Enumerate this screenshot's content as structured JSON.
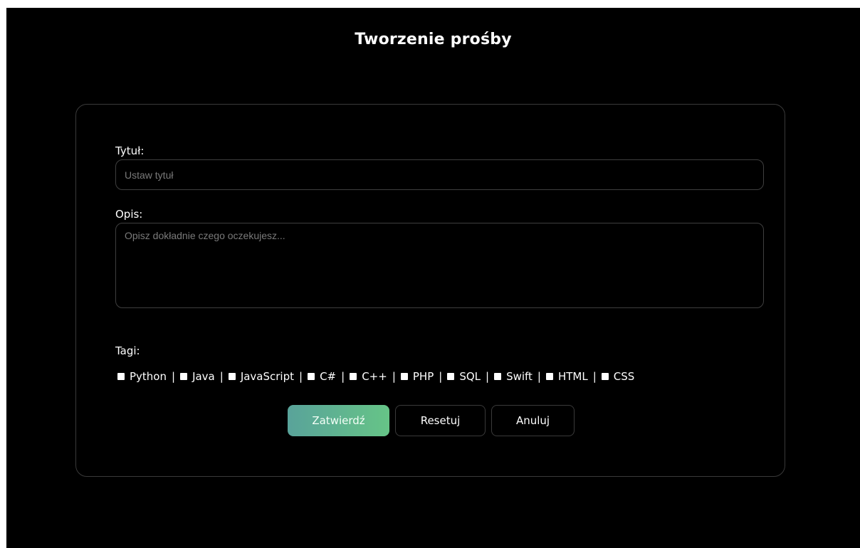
{
  "page": {
    "title": "Tworzenie prośby"
  },
  "form": {
    "title_label": "Tytuł:",
    "title_placeholder": "Ustaw tytuł",
    "description_label": "Opis:",
    "description_placeholder": "Opisz dokładnie czego oczekujesz...",
    "tags_label": "Tagi:",
    "tags": [
      {
        "label": "Python"
      },
      {
        "label": "Java"
      },
      {
        "label": "JavaScript"
      },
      {
        "label": "C#"
      },
      {
        "label": "C++"
      },
      {
        "label": "PHP"
      },
      {
        "label": "SQL"
      },
      {
        "label": "Swift"
      },
      {
        "label": "HTML"
      },
      {
        "label": "CSS"
      }
    ],
    "tag_separator": "|"
  },
  "buttons": {
    "submit": "Zatwierdź",
    "reset": "Resetuj",
    "cancel": "Anuluj"
  },
  "colors": {
    "background": "#000000",
    "submit_gradient_start": "#59a39a",
    "submit_gradient_end": "#66c487",
    "border": "#3a3a3a"
  }
}
